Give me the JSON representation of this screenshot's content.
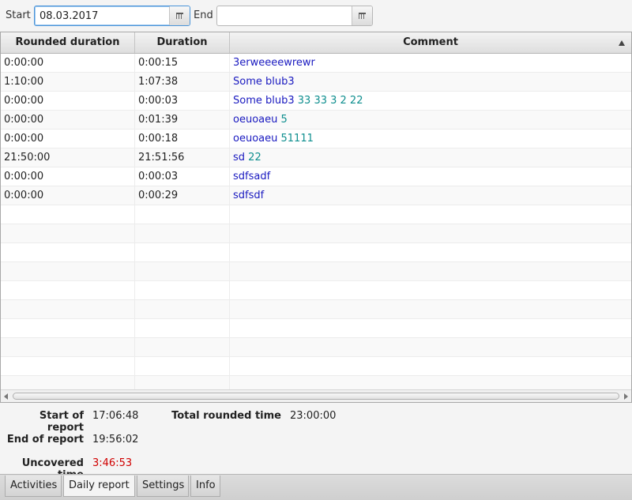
{
  "filters": {
    "start_label": "Start",
    "start_value": "08.03.2017",
    "end_label": "End",
    "end_value": ""
  },
  "table": {
    "columns": [
      "Rounded duration",
      "Duration",
      "Comment"
    ],
    "sort_column": "Comment",
    "rows": [
      {
        "rounded": "0:00:00",
        "duration": "0:00:15",
        "comment": "3erweeeewrewr",
        "tags": ""
      },
      {
        "rounded": "1:10:00",
        "duration": "1:07:38",
        "comment": "Some blub3",
        "tags": ""
      },
      {
        "rounded": "0:00:00",
        "duration": "0:00:03",
        "comment": "Some blub3",
        "tags": "33 33 3 2 22"
      },
      {
        "rounded": "0:00:00",
        "duration": "0:01:39",
        "comment": "oeuoaeu",
        "tags": "5"
      },
      {
        "rounded": "0:00:00",
        "duration": "0:00:18",
        "comment": "oeuoaeu",
        "tags": "51111"
      },
      {
        "rounded": "21:50:00",
        "duration": "21:51:56",
        "comment": "sd",
        "tags": "22"
      },
      {
        "rounded": "0:00:00",
        "duration": "0:00:03",
        "comment": "sdfsadf",
        "tags": ""
      },
      {
        "rounded": "0:00:00",
        "duration": "0:00:29",
        "comment": "sdfsdf",
        "tags": ""
      }
    ]
  },
  "summary": {
    "start_label": "Start of report",
    "start_value": "17:06:48",
    "end_label": "End of report",
    "end_value": "19:56:02",
    "uncovered_label": "Uncovered time",
    "uncovered_value": "3:46:53",
    "total_label": "Total rounded time",
    "total_value": "23:00:00"
  },
  "tabs": [
    {
      "label": "Activities",
      "selected": false
    },
    {
      "label": "Daily report",
      "selected": true
    },
    {
      "label": "Settings",
      "selected": false
    },
    {
      "label": "Info",
      "selected": false
    }
  ],
  "colors": {
    "comment": "#1a1ac0",
    "tag": "#0f8f8f",
    "uncovered": "#d00000"
  },
  "icons": [
    "calendar-icon",
    "sort-ascending-icon",
    "scroll-left-icon",
    "scroll-right-icon"
  ]
}
